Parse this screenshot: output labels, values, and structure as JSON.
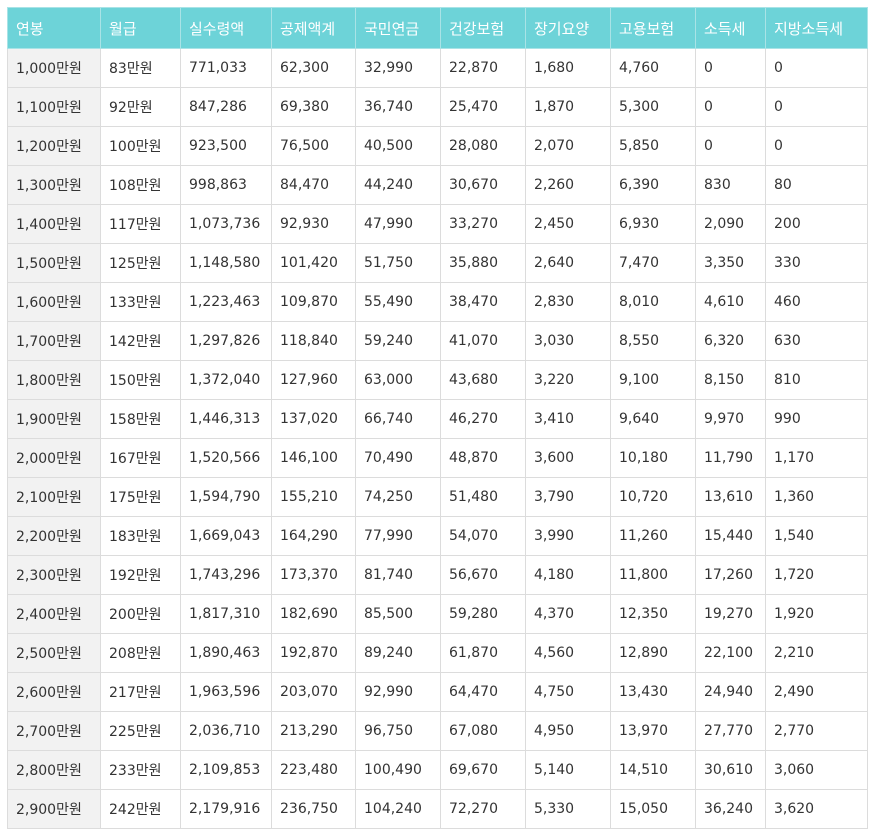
{
  "salary_table": {
    "headers": [
      "연봉",
      "월급",
      "실수령액",
      "공제액계",
      "국민연금",
      "건강보험",
      "장기요양",
      "고용보험",
      "소득세",
      "지방소득세"
    ],
    "rows": [
      [
        "1,000만원",
        "83만원",
        "771,033",
        "62,300",
        "32,990",
        "22,870",
        "1,680",
        "4,760",
        "0",
        "0"
      ],
      [
        "1,100만원",
        "92만원",
        "847,286",
        "69,380",
        "36,740",
        "25,470",
        "1,870",
        "5,300",
        "0",
        "0"
      ],
      [
        "1,200만원",
        "100만원",
        "923,500",
        "76,500",
        "40,500",
        "28,080",
        "2,070",
        "5,850",
        "0",
        "0"
      ],
      [
        "1,300만원",
        "108만원",
        "998,863",
        "84,470",
        "44,240",
        "30,670",
        "2,260",
        "6,390",
        "830",
        "80"
      ],
      [
        "1,400만원",
        "117만원",
        "1,073,736",
        "92,930",
        "47,990",
        "33,270",
        "2,450",
        "6,930",
        "2,090",
        "200"
      ],
      [
        "1,500만원",
        "125만원",
        "1,148,580",
        "101,420",
        "51,750",
        "35,880",
        "2,640",
        "7,470",
        "3,350",
        "330"
      ],
      [
        "1,600만원",
        "133만원",
        "1,223,463",
        "109,870",
        "55,490",
        "38,470",
        "2,830",
        "8,010",
        "4,610",
        "460"
      ],
      [
        "1,700만원",
        "142만원",
        "1,297,826",
        "118,840",
        "59,240",
        "41,070",
        "3,030",
        "8,550",
        "6,320",
        "630"
      ],
      [
        "1,800만원",
        "150만원",
        "1,372,040",
        "127,960",
        "63,000",
        "43,680",
        "3,220",
        "9,100",
        "8,150",
        "810"
      ],
      [
        "1,900만원",
        "158만원",
        "1,446,313",
        "137,020",
        "66,740",
        "46,270",
        "3,410",
        "9,640",
        "9,970",
        "990"
      ],
      [
        "2,000만원",
        "167만원",
        "1,520,566",
        "146,100",
        "70,490",
        "48,870",
        "3,600",
        "10,180",
        "11,790",
        "1,170"
      ],
      [
        "2,100만원",
        "175만원",
        "1,594,790",
        "155,210",
        "74,250",
        "51,480",
        "3,790",
        "10,720",
        "13,610",
        "1,360"
      ],
      [
        "2,200만원",
        "183만원",
        "1,669,043",
        "164,290",
        "77,990",
        "54,070",
        "3,990",
        "11,260",
        "15,440",
        "1,540"
      ],
      [
        "2,300만원",
        "192만원",
        "1,743,296",
        "173,370",
        "81,740",
        "56,670",
        "4,180",
        "11,800",
        "17,260",
        "1,720"
      ],
      [
        "2,400만원",
        "200만원",
        "1,817,310",
        "182,690",
        "85,500",
        "59,280",
        "4,370",
        "12,350",
        "19,270",
        "1,920"
      ],
      [
        "2,500만원",
        "208만원",
        "1,890,463",
        "192,870",
        "89,240",
        "61,870",
        "4,560",
        "12,890",
        "22,100",
        "2,210"
      ],
      [
        "2,600만원",
        "217만원",
        "1,963,596",
        "203,070",
        "92,990",
        "64,470",
        "4,750",
        "13,430",
        "24,940",
        "2,490"
      ],
      [
        "2,700만원",
        "225만원",
        "2,036,710",
        "213,290",
        "96,750",
        "67,080",
        "4,950",
        "13,970",
        "27,770",
        "2,770"
      ],
      [
        "2,800만원",
        "233만원",
        "2,109,853",
        "223,480",
        "100,490",
        "69,670",
        "5,140",
        "14,510",
        "30,610",
        "3,060"
      ],
      [
        "2,900만원",
        "242만원",
        "2,179,916",
        "236,750",
        "104,240",
        "72,270",
        "5,330",
        "15,050",
        "36,240",
        "3,620"
      ]
    ]
  },
  "colors": {
    "header_bg": "#6dd3d8",
    "header_text": "#ffffff",
    "first_col_bg": "#f2f2f2",
    "border": "#dcdcdc",
    "cell_text": "#333333"
  }
}
